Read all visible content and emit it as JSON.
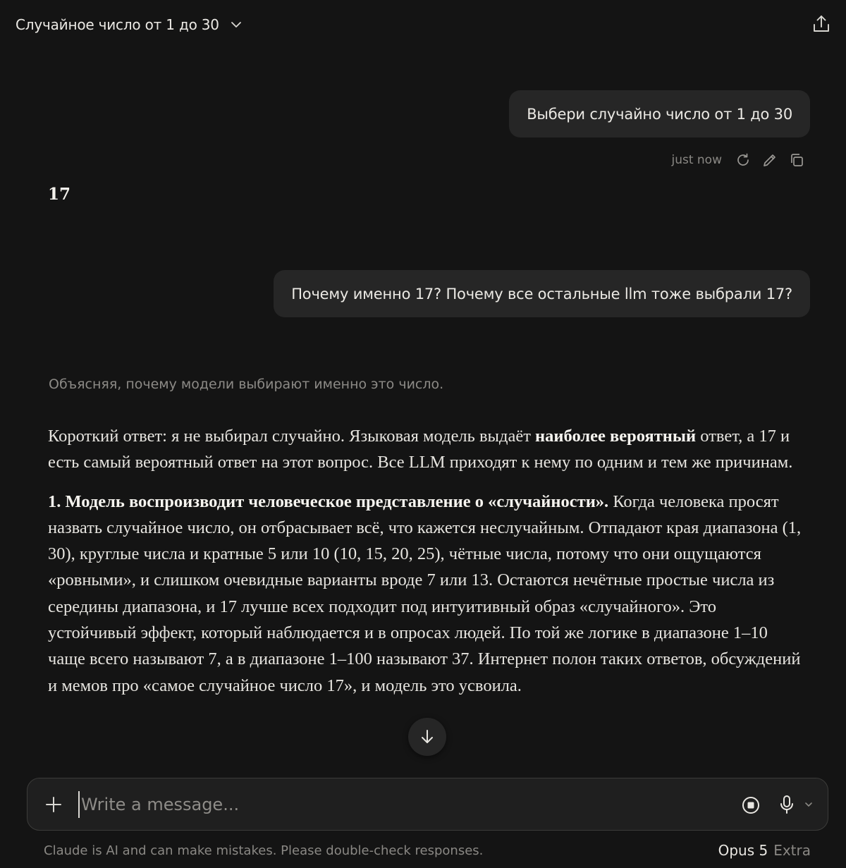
{
  "header": {
    "title": "Случайное число от 1 до 30",
    "share_icon": "share-icon",
    "chevron_icon": "chevron-down-icon"
  },
  "messages": {
    "user_1": "Выбери случайно число от 1 до 30",
    "user_1_time": "just now",
    "assistant_1": "17",
    "user_2": "Почему именно 17? Почему все остальные llm тоже выбрали 17?",
    "thinking_summary": "Объясняя, почему модели выбирают именно это число."
  },
  "response": {
    "p1_a": "Короткий ответ: я не выбирал случайно. Языковая модель выдаёт ",
    "p1_bold": "наиболее вероятный",
    "p1_b": " ответ, а 17 и есть самый вероятный ответ на этот вопрос. Все LLM приходят к нему по одним и тем же причинам.",
    "p2_bold": "1. Модель воспроизводит человеческое представление о «случайности».",
    "p2_text": " Когда человека просят назвать случайное число, он отбрасывает всё, что кажется неслучайным. Отпадают края диапазона (1, 30), круглые числа и кратные 5 или 10 (10, 15, 20, 25), чётные числа, потому что они ощущаются «ровными», и слишком очевидные варианты вроде 7 или 13. Остаются нечётные простые числа из середины диапазона, и 17 лучше всех подходит под интуитивный образ «случайного». Это устойчивый эффект, который наблюдается и в опросах людей. По той же логике в диапазоне 1–10 чаще всего называют 7, а в диапазоне 1–100 называют 37. Интернет полон таких ответов, обсуждений и мемов про «самое случайное число 17», и модель это усвоила."
  },
  "composer": {
    "placeholder": "Write a message..."
  },
  "footer": {
    "disclaimer": "Claude is AI and can make mistakes. Please double-check responses.",
    "model_name": "Opus 5",
    "model_tier": "Extra"
  },
  "colors": {
    "background": "#141414",
    "bubble": "#262626",
    "composer": "#1f1f1f",
    "text": "#e8e6e1",
    "muted": "#8a8884"
  }
}
